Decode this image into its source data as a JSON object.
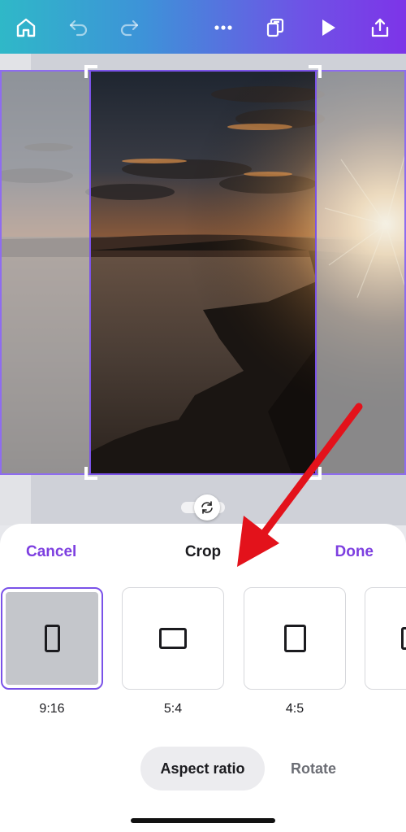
{
  "toolbar": {
    "icons": [
      "home-icon",
      "undo-icon",
      "redo-icon",
      "more-icon",
      "pages-icon",
      "play-icon",
      "share-icon"
    ],
    "gradient": [
      "#2fb8c8",
      "#7d34e8"
    ]
  },
  "canvas": {
    "frame_color": "#7a52e8",
    "handle_icon": "rotate-icon"
  },
  "crop_sheet": {
    "cancel_label": "Cancel",
    "title": "Crop",
    "done_label": "Done",
    "accent": "#7d3fe0",
    "options": [
      {
        "label": "9:16",
        "selected": true
      },
      {
        "label": "5:4",
        "selected": false
      },
      {
        "label": "4:5",
        "selected": false
      },
      {
        "label": "",
        "selected": false
      }
    ],
    "tabs": {
      "aspect_ratio": "Aspect ratio",
      "rotate": "Rotate",
      "active": "aspect_ratio"
    }
  },
  "annotation": {
    "arrow_color": "#e3121b"
  }
}
